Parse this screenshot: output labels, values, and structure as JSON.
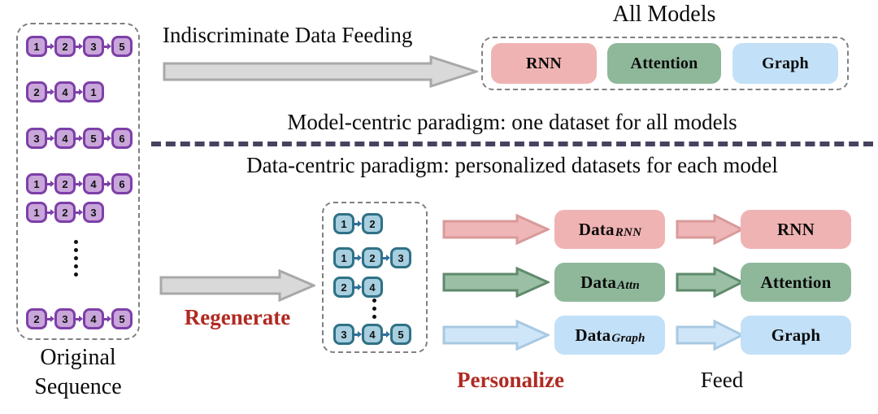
{
  "figure": {
    "title_top": "All Models",
    "heading_top_flow": "Indiscriminate Data Feeding",
    "paradigm_model": "Model-centric paradigm: one dataset for all models",
    "paradigm_data": "Data-centric paradigm: personalized datasets for each model",
    "label_original": "Original",
    "label_sequence": "Sequence",
    "label_regenerate": "Regenerate",
    "label_personalize": "Personalize",
    "label_feed": "Feed"
  },
  "colors": {
    "rnn": "#f0b3b3",
    "attention": "#8fb89b",
    "graph": "#c2e0f7",
    "node_purple_fill": "#c9a6da",
    "node_purple_border": "#7d3fa8",
    "node_blue_fill": "#a8cfe0",
    "node_blue_border": "#2f7186",
    "accent_red": "#b02a22",
    "divider": "#44445f",
    "gray_arrow": "#d4d4d4",
    "gray_arrow_border": "#a6a6a6",
    "dashed_border": "#808080"
  },
  "original_sequences": {
    "rows": [
      {
        "tokens": [
          "1",
          "2",
          "3",
          "5"
        ]
      },
      {
        "tokens": [
          "2",
          "4",
          "1"
        ]
      },
      {
        "tokens": [
          "3",
          "4",
          "5",
          "6"
        ]
      },
      {
        "tokens": [
          "1",
          "2",
          "4",
          "6"
        ]
      },
      {
        "tokens": [
          "1",
          "2",
          "3"
        ]
      },
      {
        "tokens": [
          "2",
          "3",
          "4",
          "5"
        ]
      }
    ],
    "ellipsis_after_row": 5
  },
  "regenerated_sequences": {
    "rows": [
      {
        "tokens": [
          "1",
          "2"
        ]
      },
      {
        "tokens": [
          "1",
          "2",
          "3"
        ]
      },
      {
        "tokens": [
          "2",
          "4"
        ]
      },
      {
        "tokens": [
          "3",
          "4",
          "5"
        ]
      }
    ],
    "ellipsis_after_row": 3
  },
  "all_models_group": {
    "items": [
      {
        "label": "RNN",
        "color_key": "rnn"
      },
      {
        "label": "Attention",
        "color_key": "attention"
      },
      {
        "label": "Graph",
        "color_key": "graph"
      }
    ]
  },
  "personalized_datasets": [
    {
      "base": "Data",
      "sub": "RNN",
      "color_key": "rnn"
    },
    {
      "base": "Data",
      "sub": "Attn",
      "color_key": "attention"
    },
    {
      "base": "Data",
      "sub": "Graph",
      "color_key": "graph"
    }
  ],
  "target_models": [
    {
      "label": "RNN",
      "color_key": "rnn"
    },
    {
      "label": "Attention",
      "color_key": "attention"
    },
    {
      "label": "Graph",
      "color_key": "graph"
    }
  ]
}
